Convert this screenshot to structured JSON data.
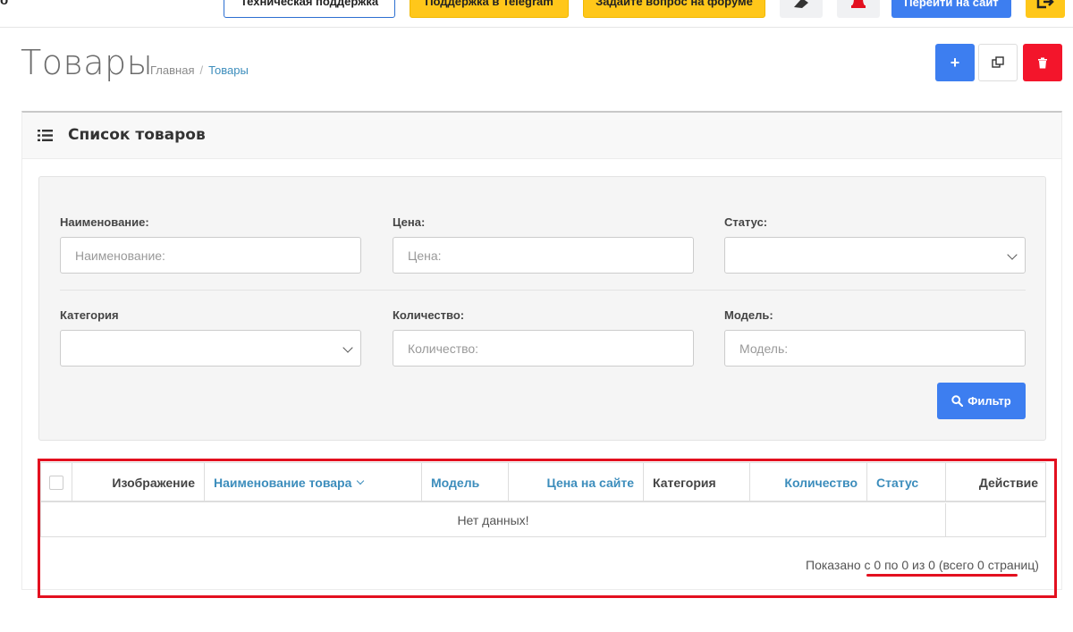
{
  "header": {
    "brand_fragment": "о",
    "buttons": {
      "support": "Техническая поддержка",
      "telegram": "Поддержка в Telegram",
      "forum": "Задайте вопрос на форуме",
      "goto_site": "Перейти на сайт"
    },
    "icons": [
      "eraser-icon",
      "bell-icon",
      "exit-icon"
    ]
  },
  "page": {
    "title": "Товары",
    "breadcrumb": [
      "Главная",
      "Товары"
    ]
  },
  "actions": {
    "add": "+",
    "copy": "⧉",
    "delete": "🗑"
  },
  "card": {
    "title": "Список товаров"
  },
  "filter": {
    "name": {
      "label": "Наименование:",
      "placeholder": "Наименование:"
    },
    "price": {
      "label": "Цена:",
      "placeholder": "Цена:"
    },
    "status": {
      "label": "Статус:",
      "value": ""
    },
    "category": {
      "label": "Категория",
      "value": ""
    },
    "quantity": {
      "label": "Количество:",
      "placeholder": "Количество:"
    },
    "model": {
      "label": "Модель:",
      "placeholder": "Модель:"
    },
    "button": "Фильтр"
  },
  "table": {
    "columns": {
      "image": "Изображение",
      "name": "Наименование товара",
      "model": "Модель",
      "price": "Цена на сайте",
      "category": "Категория",
      "quantity": "Количество",
      "status": "Статус",
      "action": "Действие"
    },
    "empty": "Нет данных!",
    "summary": "Показано с 0 по 0 из 0 (всего 0 страниц)"
  },
  "colors": {
    "primary": "#3d7ef0",
    "warning": "#ffc71a",
    "danger": "#f3152b",
    "link": "#3c8dbc",
    "annotation": "#e3101f"
  }
}
